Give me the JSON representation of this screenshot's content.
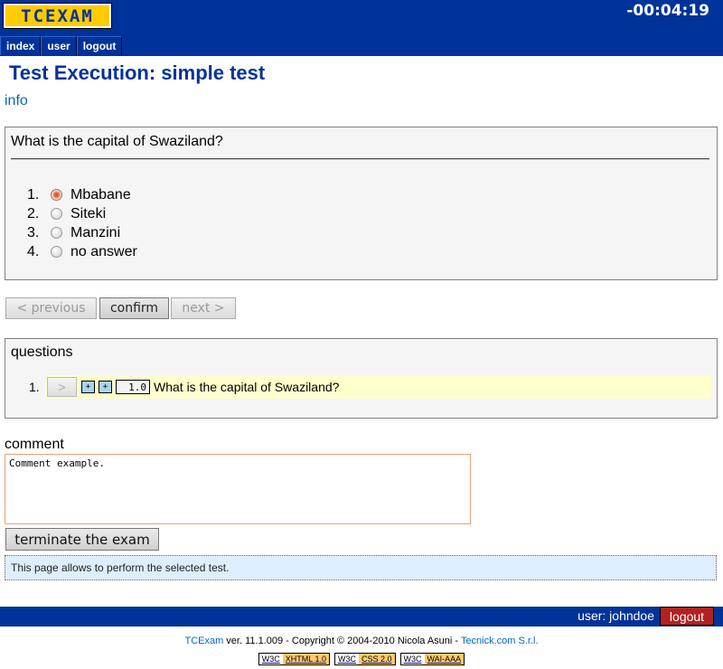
{
  "header": {
    "logo_text": "TCEXAM",
    "timer": "-00:04:19",
    "menu": [
      {
        "label": "index"
      },
      {
        "label": "user"
      },
      {
        "label": "logout"
      }
    ]
  },
  "page": {
    "title": "Test Execution: simple test",
    "info_link": "info"
  },
  "question": {
    "text": "What is the capital of Swaziland?",
    "answers": [
      {
        "num": "1.",
        "label": "Mbabane",
        "selected": true
      },
      {
        "num": "2.",
        "label": "Siteki",
        "selected": false
      },
      {
        "num": "3.",
        "label": "Manzini",
        "selected": false
      },
      {
        "num": "4.",
        "label": "no answer",
        "selected": false
      }
    ]
  },
  "nav_buttons": {
    "previous": "< previous",
    "confirm": "confirm",
    "next": "next >"
  },
  "questions_list": {
    "title": "questions",
    "items": [
      {
        "num": "1.",
        "goto_label": ">",
        "flag1": "+",
        "flag2": "+",
        "score": "1.0",
        "text": "What is the capital of Swaziland?"
      }
    ]
  },
  "comment": {
    "label": "comment",
    "value": "Comment example."
  },
  "terminate_label": "terminate the exam",
  "help_text": "This page allows to perform the selected test.",
  "userbar": {
    "user_label": "user: johndoe",
    "logout_label": "logout"
  },
  "footer": {
    "app_link": "TCExam",
    "text": " ver. 11.1.009 - Copyright © 2004-2010 Nicola Asuni - ",
    "company_link": "Tecnick.com S.r.l.",
    "badges": [
      {
        "org": "W3C",
        "std": "XHTML 1.0"
      },
      {
        "org": "W3C",
        "std": "CSS 2.0"
      },
      {
        "org": "W3C",
        "std": "WAI-AAA"
      }
    ]
  },
  "colors": {
    "brand_blue": "#003399",
    "logo_yellow": "#ffcc00",
    "highlight_row": "#ffffcc",
    "logout_red": "#b22222",
    "help_bg": "#ddeeff"
  }
}
